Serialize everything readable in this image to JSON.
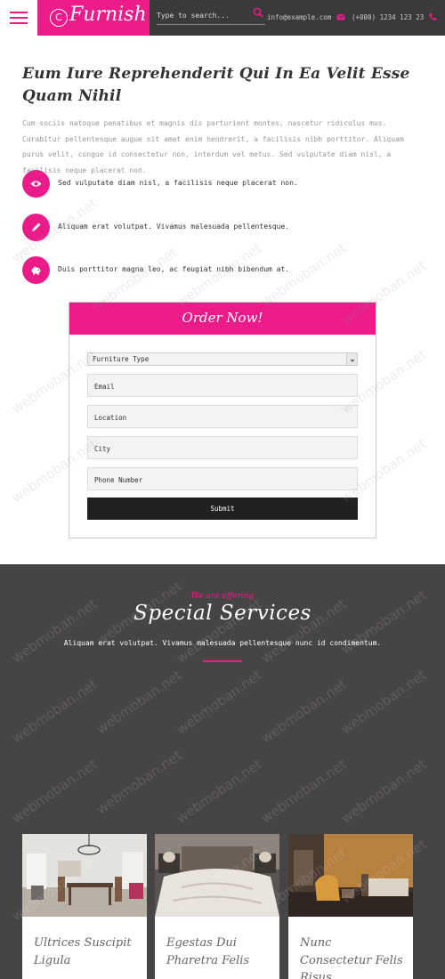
{
  "header": {
    "logo_letter": "C",
    "logo_text": "Furnish",
    "search_placeholder": "Type to search...",
    "email": "info@example.com",
    "phone": "(+000) 1234 123 23"
  },
  "intro": {
    "title": "Eum Iure Reprehenderit Qui In Ea Velit Esse Quam Nihil",
    "paragraph": "Cum sociis natoque penatibus et magnis dis parturient montes, nascetur ridiculus mus. Curabitur pellentesque augue sit amet enim hendrerit, a facilisis nibh porttitor. Aliquam purus velit, congue id consectetur non, interdum vel metus. Sed vulputate diam nisl, a facilisis neque placerat non."
  },
  "features": [
    {
      "icon": "eye-icon",
      "text": "Sed vulputate diam nisl, a facilisis neque placerat non."
    },
    {
      "icon": "pencil-icon",
      "text": "Aliquam erat volutpat. Vivamus malesuada pellentesque."
    },
    {
      "icon": "piggy-bank-icon",
      "text": "Duis porttitor magna leo, ac feugiat nibh bibendum at."
    }
  ],
  "order_form": {
    "title": "Order Now!",
    "select_value": "Furniture Type",
    "fields": [
      "Email",
      "Location",
      "City",
      "Phone Number"
    ],
    "submit_label": "Submit"
  },
  "services": {
    "eyebrow": "We are offering",
    "title": "Special Services",
    "subtitle": "Aliquam erat volutpat. Vivamus malesuada pellentesque nunc id condimentum.",
    "cards": [
      {
        "title": "Ultrices Suscipit Ligula"
      },
      {
        "title": "Egestas Dui Pharetra Felis"
      },
      {
        "title": "Nunc Consectetur Felis Risus"
      }
    ]
  },
  "watermark": "webmoban.net",
  "colors": {
    "accent": "#ec1b8a",
    "dark": "#474446",
    "header": "#3a3a3a"
  }
}
